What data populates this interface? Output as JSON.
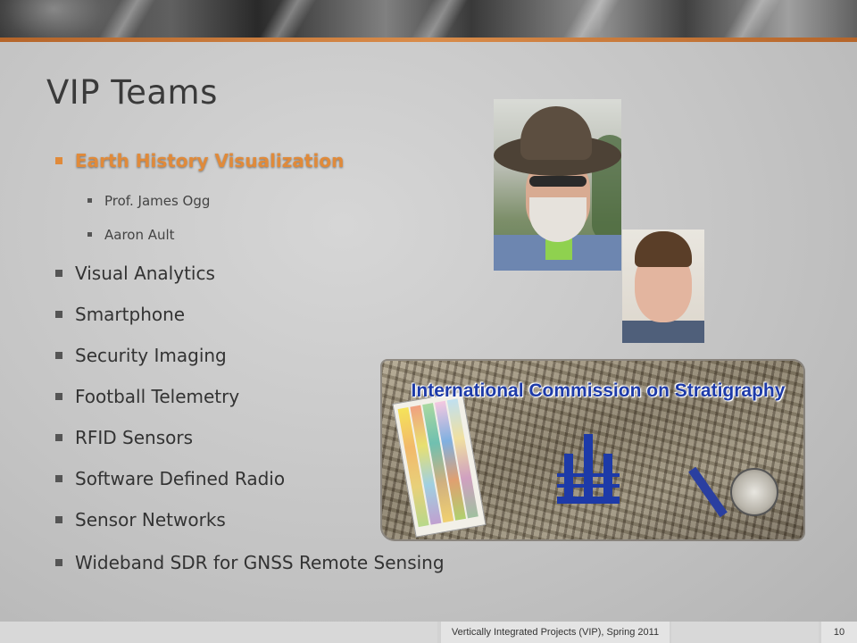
{
  "slide": {
    "title": "VIP Teams",
    "bullets": [
      {
        "label": "Earth History Visualization",
        "highlighted": true,
        "sub": [
          "Prof. James Ogg",
          "Aaron Ault"
        ]
      },
      {
        "label": "Visual Analytics",
        "highlighted": false,
        "sub": []
      },
      {
        "label": "Smartphone",
        "highlighted": false,
        "sub": []
      },
      {
        "label": "Security Imaging",
        "highlighted": false,
        "sub": []
      },
      {
        "label": "Football Telemetry",
        "highlighted": false,
        "sub": []
      },
      {
        "label": "RFID Sensors",
        "highlighted": false,
        "sub": []
      },
      {
        "label": "Software Defined Radio",
        "highlighted": false,
        "sub": []
      },
      {
        "label": "Sensor Networks",
        "highlighted": false,
        "sub": []
      },
      {
        "label": "Wideband SDR for GNSS Remote Sensing",
        "highlighted": false,
        "sub": []
      }
    ]
  },
  "images": {
    "banner_title": "International Commission on Stratigraphy"
  },
  "footer": {
    "text": "Vertically Integrated Projects (VIP), Spring 2011",
    "page_number": "10"
  },
  "colors": {
    "accent": "#e08a3a",
    "header_rule": "#c8783a",
    "banner_text": "#1d3aa8"
  }
}
